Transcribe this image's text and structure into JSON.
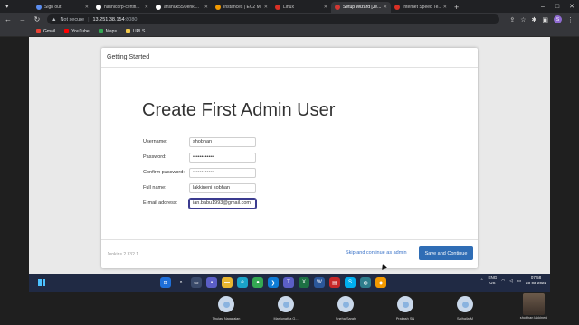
{
  "browser": {
    "tabs": [
      {
        "label": "Sign out",
        "color": "#5b8def",
        "active": false
      },
      {
        "label": "hashicorp-certifi...",
        "color": "#ffffff",
        "active": false
      },
      {
        "label": "anshuk55/Jenki...",
        "color": "#ffffff",
        "active": false
      },
      {
        "label": "Instances | EC2 M...",
        "color": "#f29900",
        "active": false
      },
      {
        "label": "Linux",
        "color": "#d93025",
        "active": false
      },
      {
        "label": "Setup Wizard [Je...",
        "color": "#d33833",
        "active": true
      },
      {
        "label": "Internet Speed Te...",
        "color": "#d93025",
        "active": false
      }
    ],
    "new_tab": "+",
    "address": {
      "security": "Not secure",
      "host": "13.251.38.154",
      "port": ":8080"
    },
    "bookmarks": [
      {
        "label": "Gmail",
        "color": "#ea4335"
      },
      {
        "label": "YouTube",
        "color": "#ff0000"
      },
      {
        "label": "Maps",
        "color": "#34a853"
      },
      {
        "label": "URLS",
        "color": "#f2c94c"
      }
    ],
    "profile_initial": "S"
  },
  "dialog": {
    "header": "Getting Started",
    "title": "Create First Admin User",
    "fields": [
      {
        "label": "Username:",
        "value": "shobhan",
        "focused": false
      },
      {
        "label": "Password:",
        "value": "••••••••••••",
        "focused": false
      },
      {
        "label": "Confirm password:",
        "value": "••••••••••••",
        "focused": false
      },
      {
        "label": "Full name:",
        "value": "lakkineni sobhan",
        "focused": false
      },
      {
        "label": "E-mail address:",
        "value": "ian.babu1993@gmail.com",
        "focused": true
      }
    ],
    "version": "Jenkins 2.332.1",
    "skip_label": "Skip and continue as admin",
    "save_label": "Save and Continue"
  },
  "taskbar": {
    "lang": "ENG",
    "region": "US",
    "time": "07:58",
    "date": "23-03-2022"
  },
  "participants": [
    {
      "name": "Thulasi Nagarajan"
    },
    {
      "name": "Manjunatha G..."
    },
    {
      "name": "Sneha Sarah"
    },
    {
      "name": "Prakash SN"
    },
    {
      "name": "Sathaila M"
    },
    {
      "name": "shobhan lakkineni"
    }
  ]
}
